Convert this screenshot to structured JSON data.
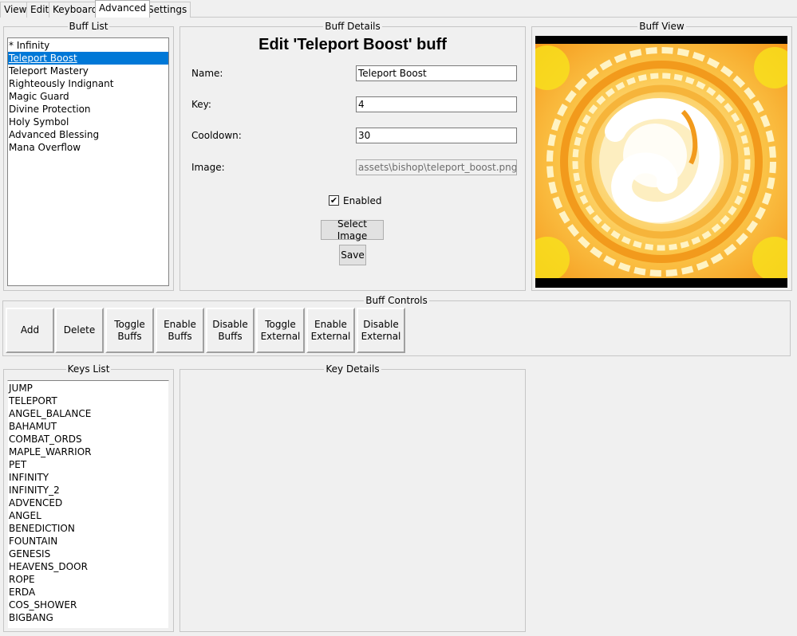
{
  "tabs": [
    {
      "label": "View",
      "active": false
    },
    {
      "label": "Edit",
      "active": false
    },
    {
      "label": "Keyboard",
      "active": false
    },
    {
      "label": "Advanced",
      "active": true
    },
    {
      "label": "Settings",
      "active": false
    }
  ],
  "buff_list": {
    "title": "Buff List",
    "items": [
      "* Infinity",
      "Teleport Boost",
      "Teleport Mastery",
      "Righteously Indignant",
      "Magic Guard",
      "Divine Protection",
      "Holy Symbol",
      "Advanced Blessing",
      "Mana Overflow"
    ],
    "selected_index": 1
  },
  "buff_details": {
    "title": "Buff Details",
    "heading": "Edit 'Teleport Boost' buff",
    "name_label": "Name:",
    "name_value": "Teleport Boost",
    "key_label": "Key:",
    "key_value": "4",
    "cooldown_label": "Cooldown:",
    "cooldown_value": "30",
    "image_label": "Image:",
    "image_value": "assets\\bishop\\teleport_boost.png",
    "enabled_label": "Enabled",
    "enabled": true,
    "select_image_label": "Select Image",
    "save_label": "Save"
  },
  "buff_view": {
    "title": "Buff View",
    "image_icon": "teleport-boost-skill-icon",
    "colors": {
      "outer": "#f5a623",
      "ring": "#fff3c4",
      "inner": "#fbe3a0",
      "accent": "#f7e21b"
    }
  },
  "buff_controls": {
    "title": "Buff Controls",
    "buttons": [
      "Add",
      "Delete",
      "Toggle\nBuffs",
      "Enable\nBuffs",
      "Disable\nBuffs",
      "Toggle\nExternal",
      "Enable\nExternal",
      "Disable\nExternal"
    ]
  },
  "keys_list": {
    "title": "Keys List",
    "items": [
      "JUMP",
      "TELEPORT",
      "ANGEL_BALANCE",
      "BAHAMUT",
      "COMBAT_ORDS",
      "MAPLE_WARRIOR",
      "PET",
      "INFINITY",
      "INFINITY_2",
      "ADVENCED",
      "ANGEL",
      "BENEDICTION",
      "FOUNTAIN",
      "GENESIS",
      "HEAVENS_DOOR",
      "ROPE",
      "ERDA",
      "COS_SHOWER",
      "BIGBANG"
    ]
  },
  "key_details": {
    "title": "Key Details"
  },
  "colors": {
    "selection": "#0078d7",
    "window_bg": "#f0f0f0"
  }
}
